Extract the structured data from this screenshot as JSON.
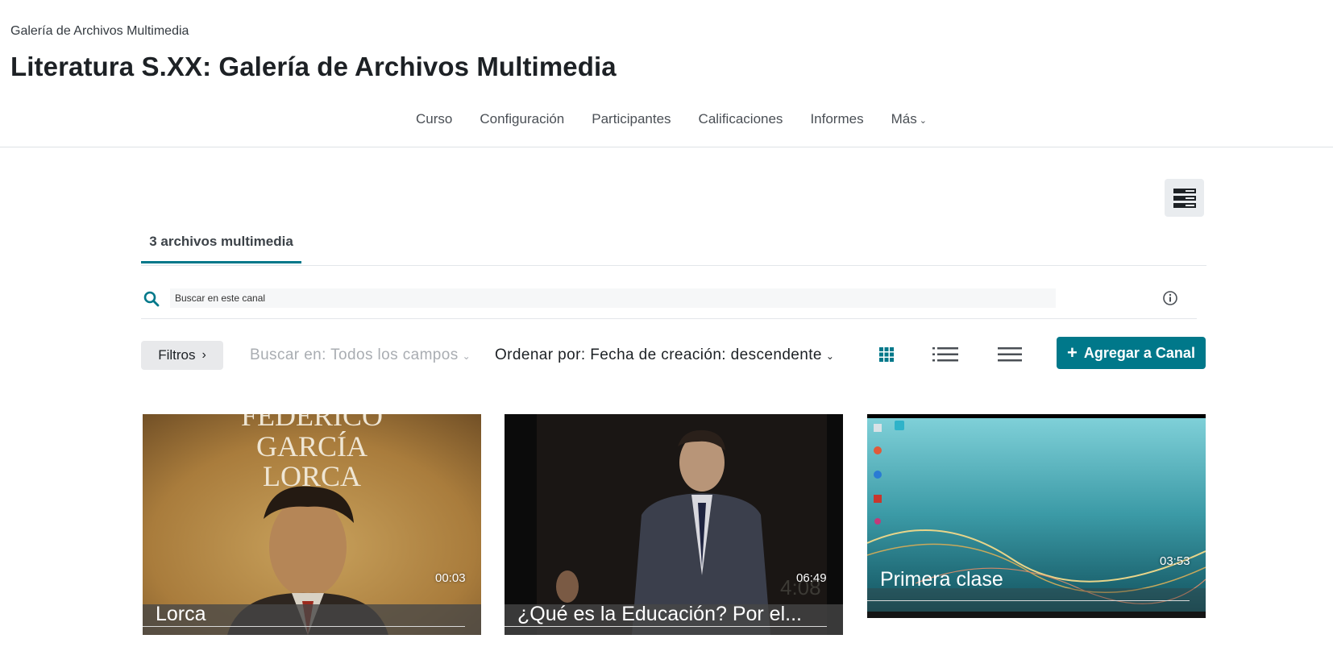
{
  "header": {
    "breadcrumb": "Galería de Archivos Multimedia",
    "page_title": "Literatura S.XX: Galería de Archivos Multimedia"
  },
  "nav": {
    "items": [
      "Curso",
      "Configuración",
      "Participantes",
      "Calificaciones",
      "Informes",
      "Más"
    ]
  },
  "tabs": [
    {
      "label": "3 archivos multimedia",
      "active": true
    }
  ],
  "search": {
    "placeholder": "Buscar en este canal",
    "value": ""
  },
  "toolbar": {
    "filters_label": "Filtros",
    "search_in_label": "Buscar en: Todos los campos",
    "sort_label": "Ordenar por: Fecha de creación: descendente",
    "add_button_label": "Agregar a Canal",
    "views": [
      "grid-view",
      "detailed-list-view",
      "compact-list-view"
    ],
    "active_view": "grid-view"
  },
  "media": [
    {
      "title": "Lorca",
      "duration": "00:03",
      "thumb_text": [
        "FEDERICO",
        "GARCÍA",
        "LORCA"
      ]
    },
    {
      "title": "¿Qué es la Educación? Por el...",
      "duration": "06:49",
      "thumb_text": [
        "4:08"
      ]
    },
    {
      "title": "Primera clase",
      "duration": "03:53",
      "thumb_text": []
    }
  ],
  "colors": {
    "accent": "#00788a",
    "text": "#1d2125",
    "muted": "#a9adb2"
  }
}
